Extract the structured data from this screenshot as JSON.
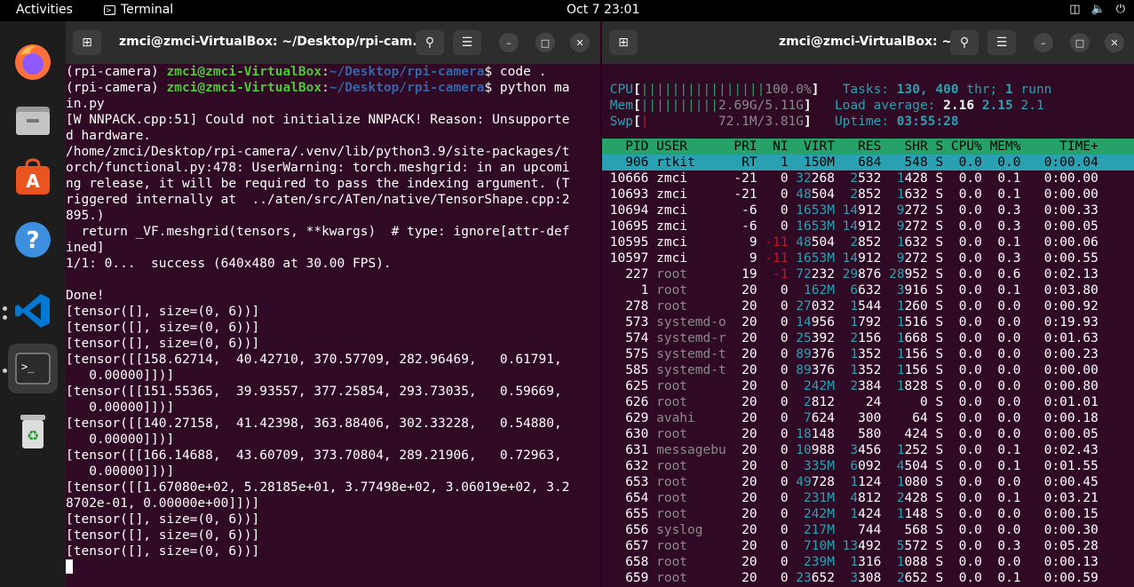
{
  "topbar": {
    "activities": "Activities",
    "app_name": "Terminal",
    "clock": "Oct 7  23:01"
  },
  "dock": {
    "apps": [
      "firefox-icon",
      "files-icon",
      "software-center-icon",
      "help-icon",
      "vscode-icon",
      "terminal-icon",
      "trash-icon"
    ]
  },
  "left_window": {
    "title": "zmci@zmci-VirtualBox: ~/Desktop/rpi-cam...",
    "prompt_env": "(rpi-camera) ",
    "prompt_user": "zmci@zmci-VirtualBox",
    "prompt_sep": ":",
    "prompt_path": "~/Desktop/rpi-camera",
    "prompt_dollar": "$ ",
    "cmd1": "code .",
    "cmd2": "python ma",
    "output": [
      "in.py",
      "[W NNPACK.cpp:51] Could not initialize NNPACK! Reason: Unsupporte",
      "d hardware.",
      "/home/zmci/Desktop/rpi-camera/.venv/lib/python3.9/site-packages/t",
      "orch/functional.py:478: UserWarning: torch.meshgrid: in an upcomi",
      "ng release, it will be required to pass the indexing argument. (T",
      "riggered internally at  ../aten/src/ATen/native/TensorShape.cpp:2",
      "895.)",
      "  return _VF.meshgrid(tensors, **kwargs)  # type: ignore[attr-def",
      "ined]",
      "1/1: 0...  success (640x480 at 30.00 FPS).",
      "",
      "Done!",
      "[tensor([], size=(0, 6))]",
      "[tensor([], size=(0, 6))]",
      "[tensor([], size=(0, 6))]",
      "[tensor([[158.62714,  40.42710, 370.57709, 282.96469,   0.61791,",
      "   0.00000]])]",
      "[tensor([[151.55365,  39.93557, 377.25854, 293.73035,   0.59669,",
      "   0.00000]])]",
      "[tensor([[140.27158,  41.42398, 363.88406, 302.33228,   0.54880,",
      "   0.00000]])]",
      "[tensor([[166.14688,  43.60709, 373.70804, 289.21906,   0.72963,",
      "   0.00000]])]",
      "[tensor([[1.67080e+02, 5.28185e+01, 3.77498e+02, 3.06019e+02, 3.2",
      "8702e-01, 0.00000e+00]])]",
      "[tensor([], size=(0, 6))]",
      "[tensor([], size=(0, 6))]",
      "[tensor([], size=(0, 6))]"
    ]
  },
  "right_window": {
    "title": "zmci@zmci-VirtualBox: ~",
    "meters": {
      "cpu_label": "CPU",
      "cpu_bar": "||||||||||||||||",
      "cpu_val": "100.0%",
      "mem_label": "Mem",
      "mem_bar": "||||||||||",
      "mem_val": "2.69G/5.11G",
      "swp_label": "Swp",
      "swp_bar": "|",
      "swp_val": "72.1M/3.81G",
      "tasks_label": "Tasks: ",
      "tasks_val": "130, 400",
      "tasks_thr": " thr; ",
      "tasks_run": "1",
      "tasks_runn": " runn",
      "load_label": "Load average: ",
      "load1": "2.16",
      "load5": "2.15",
      "load15": "2.1",
      "uptime_label": "Uptime: ",
      "uptime_val": "03:55:28"
    },
    "columns": [
      "PID",
      "USER",
      "PRI",
      "NI",
      "VIRT",
      "RES",
      "SHR",
      "S",
      "CPU%",
      "MEM%",
      "TIME+"
    ],
    "rows": [
      [
        "906",
        "rtkit",
        "RT",
        "1",
        "150M",
        "684",
        "548",
        "S",
        "0.0",
        "0.0",
        "0:00.04"
      ],
      [
        "10666",
        "zmci",
        "-21",
        "0",
        "32268",
        "2532",
        "1428",
        "S",
        "0.0",
        "0.1",
        "0:00.00"
      ],
      [
        "10693",
        "zmci",
        "-21",
        "0",
        "48504",
        "2852",
        "1632",
        "S",
        "0.0",
        "0.1",
        "0:00.00"
      ],
      [
        "10694",
        "zmci",
        "-6",
        "0",
        "1653M",
        "14912",
        "9272",
        "S",
        "0.0",
        "0.3",
        "0:00.33"
      ],
      [
        "10695",
        "zmci",
        "-6",
        "0",
        "1653M",
        "14912",
        "9272",
        "S",
        "0.0",
        "0.3",
        "0:00.05"
      ],
      [
        "10595",
        "zmci",
        "9",
        "-11",
        "48504",
        "2852",
        "1632",
        "S",
        "0.0",
        "0.1",
        "0:00.06"
      ],
      [
        "10597",
        "zmci",
        "9",
        "-11",
        "1653M",
        "14912",
        "9272",
        "S",
        "0.0",
        "0.3",
        "0:00.55"
      ],
      [
        "227",
        "root",
        "19",
        "-1",
        "72232",
        "29876",
        "28952",
        "S",
        "0.0",
        "0.6",
        "0:02.13"
      ],
      [
        "1",
        "root",
        "20",
        "0",
        "162M",
        "6632",
        "3916",
        "S",
        "0.0",
        "0.1",
        "0:03.80"
      ],
      [
        "278",
        "root",
        "20",
        "0",
        "27032",
        "1544",
        "1260",
        "S",
        "0.0",
        "0.0",
        "0:00.92"
      ],
      [
        "573",
        "systemd-o",
        "20",
        "0",
        "14956",
        "1792",
        "1516",
        "S",
        "0.0",
        "0.0",
        "0:19.93"
      ],
      [
        "574",
        "systemd-r",
        "20",
        "0",
        "25392",
        "2156",
        "1668",
        "S",
        "0.0",
        "0.0",
        "0:01.63"
      ],
      [
        "575",
        "systemd-t",
        "20",
        "0",
        "89376",
        "1352",
        "1156",
        "S",
        "0.0",
        "0.0",
        "0:00.23"
      ],
      [
        "585",
        "systemd-t",
        "20",
        "0",
        "89376",
        "1352",
        "1156",
        "S",
        "0.0",
        "0.0",
        "0:00.00"
      ],
      [
        "625",
        "root",
        "20",
        "0",
        "242M",
        "2384",
        "1828",
        "S",
        "0.0",
        "0.0",
        "0:00.80"
      ],
      [
        "626",
        "root",
        "20",
        "0",
        "2812",
        "24",
        "0",
        "S",
        "0.0",
        "0.0",
        "0:01.01"
      ],
      [
        "629",
        "avahi",
        "20",
        "0",
        "7624",
        "300",
        "64",
        "S",
        "0.0",
        "0.0",
        "0:00.18"
      ],
      [
        "630",
        "root",
        "20",
        "0",
        "18148",
        "580",
        "424",
        "S",
        "0.0",
        "0.0",
        "0:00.05"
      ],
      [
        "631",
        "messagebu",
        "20",
        "0",
        "10988",
        "3456",
        "1252",
        "S",
        "0.0",
        "0.1",
        "0:02.43"
      ],
      [
        "632",
        "root",
        "20",
        "0",
        "335M",
        "6092",
        "4504",
        "S",
        "0.0",
        "0.1",
        "0:01.55"
      ],
      [
        "653",
        "root",
        "20",
        "0",
        "49728",
        "1124",
        "1080",
        "S",
        "0.0",
        "0.0",
        "0:00.45"
      ],
      [
        "654",
        "root",
        "20",
        "0",
        "231M",
        "4812",
        "2428",
        "S",
        "0.0",
        "0.1",
        "0:03.21"
      ],
      [
        "655",
        "root",
        "20",
        "0",
        "242M",
        "1424",
        "1148",
        "S",
        "0.0",
        "0.0",
        "0:00.15"
      ],
      [
        "656",
        "syslog",
        "20",
        "0",
        "217M",
        "744",
        "568",
        "S",
        "0.0",
        "0.0",
        "0:00.30"
      ],
      [
        "657",
        "root",
        "20",
        "0",
        "710M",
        "13492",
        "5572",
        "S",
        "0.0",
        "0.3",
        "0:05.28"
      ],
      [
        "658",
        "root",
        "20",
        "0",
        "239M",
        "1316",
        "1088",
        "S",
        "0.0",
        "0.0",
        "0:00.13"
      ],
      [
        "659",
        "root",
        "20",
        "0",
        "23652",
        "3308",
        "2652",
        "S",
        "0.0",
        "0.1",
        "0:00.59"
      ]
    ]
  }
}
